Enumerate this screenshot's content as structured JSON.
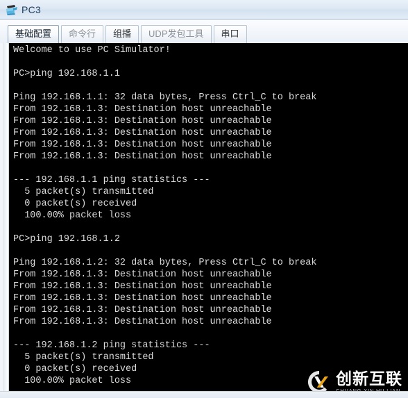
{
  "window": {
    "title": "PC3",
    "icon": "pc-terminal-icon"
  },
  "tabs": [
    {
      "label": "基础配置",
      "state": "selected"
    },
    {
      "label": "命令行",
      "state": "dim"
    },
    {
      "label": "组播",
      "state": "normal"
    },
    {
      "label": "UDP发包工具",
      "state": "dim"
    },
    {
      "label": "串口",
      "state": "normal"
    }
  ],
  "terminal": {
    "background": "#000000",
    "foreground": "#dcdcdc",
    "lines": [
      "Welcome to use PC Simulator!",
      "",
      "PC>ping 192.168.1.1",
      "",
      "Ping 192.168.1.1: 32 data bytes, Press Ctrl_C to break",
      "From 192.168.1.3: Destination host unreachable",
      "From 192.168.1.3: Destination host unreachable",
      "From 192.168.1.3: Destination host unreachable",
      "From 192.168.1.3: Destination host unreachable",
      "From 192.168.1.3: Destination host unreachable",
      "",
      "--- 192.168.1.1 ping statistics ---",
      "  5 packet(s) transmitted",
      "  0 packet(s) received",
      "  100.00% packet loss",
      "",
      "PC>ping 192.168.1.2",
      "",
      "Ping 192.168.1.2: 32 data bytes, Press Ctrl_C to break",
      "From 192.168.1.3: Destination host unreachable",
      "From 192.168.1.3: Destination host unreachable",
      "From 192.168.1.3: Destination host unreachable",
      "From 192.168.1.3: Destination host unreachable",
      "From 192.168.1.3: Destination host unreachable",
      "",
      "--- 192.168.1.2 ping statistics ---",
      "  5 packet(s) transmitted",
      "  0 packet(s) received",
      "  100.00% packet loss"
    ]
  },
  "watermark": {
    "brand_cn": "创新互联",
    "brand_en": "CHUANG XIN HU LIAN",
    "logo_accent": "#e8a317"
  }
}
